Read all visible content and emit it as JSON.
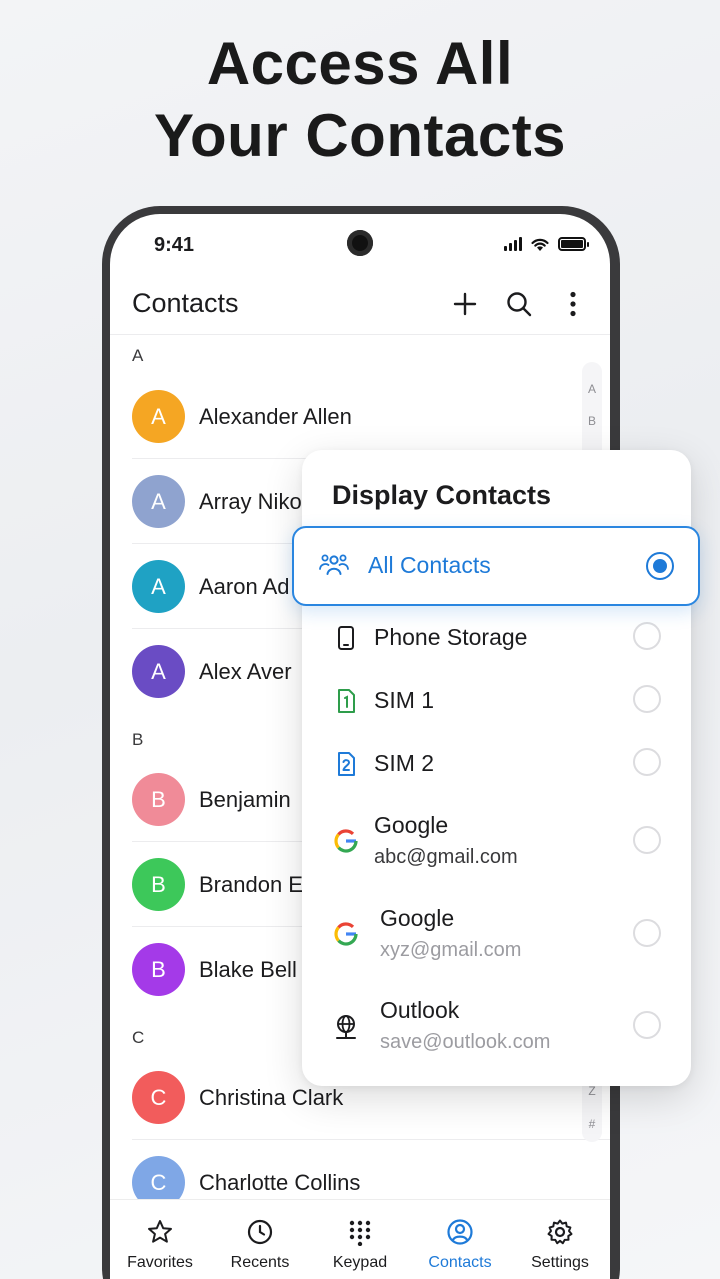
{
  "headline": {
    "line1": "Access All",
    "line2": "Your Contacts"
  },
  "status_bar": {
    "time": "9:41"
  },
  "appbar": {
    "title": "Contacts",
    "actions": [
      "add-icon",
      "search-icon",
      "more-vert-icon"
    ]
  },
  "sections": [
    {
      "letter": "A"
    },
    {
      "letter": "B"
    },
    {
      "letter": "C"
    }
  ],
  "contacts": [
    {
      "initial": "A",
      "name": "Alexander Allen",
      "color": "#F5A623"
    },
    {
      "initial": "A",
      "name": "Array Niko",
      "color": "#8FA3CF"
    },
    {
      "initial": "A",
      "name": "Aaron Ad",
      "color": "#1FA2C4"
    },
    {
      "initial": "A",
      "name": "Alex Aver",
      "color": "#6A4CC4"
    },
    {
      "initial": "B",
      "name": "Benjamin",
      "color": "#F08B98"
    },
    {
      "initial": "B",
      "name": "Brandon E",
      "color": "#3DC85A"
    },
    {
      "initial": "B",
      "name": "Blake Bell",
      "color": "#A43AE8"
    },
    {
      "initial": "C",
      "name": "Christina Clark",
      "color": "#F25C5C"
    },
    {
      "initial": "C",
      "name": "Charlotte Collins",
      "color": "#7FA7E6"
    }
  ],
  "index_bar": {
    "letters": [
      "A",
      "B",
      "Z",
      "#"
    ]
  },
  "bottom_nav": {
    "items": [
      {
        "label": "Favorites",
        "icon": "star-icon"
      },
      {
        "label": "Recents",
        "icon": "clock-icon"
      },
      {
        "label": "Keypad",
        "icon": "keypad-icon"
      },
      {
        "label": "Contacts",
        "icon": "person-circle-icon",
        "active": true
      },
      {
        "label": "Settings",
        "icon": "gear-icon"
      }
    ]
  },
  "display_contacts": {
    "title": "Display Contacts",
    "selected": {
      "label": "All Contacts",
      "icon": "group-icon"
    },
    "options": [
      {
        "label": "Phone Storage",
        "icon": "phone-icon"
      },
      {
        "label": "SIM 1",
        "icon": "sim1-icon"
      },
      {
        "label": "SIM 2",
        "icon": "sim2-icon"
      },
      {
        "label": "Google",
        "sub": "abc@gmail.com",
        "icon": "google-icon"
      },
      {
        "label": "Google",
        "sub": "xyz@gmail.com",
        "icon": "google-icon"
      },
      {
        "label": "Outlook",
        "sub": "save@outlook.com",
        "icon": "globe-icon"
      }
    ]
  },
  "colors": {
    "accent": "#1E7AD8",
    "text": "#1C1C1E"
  }
}
